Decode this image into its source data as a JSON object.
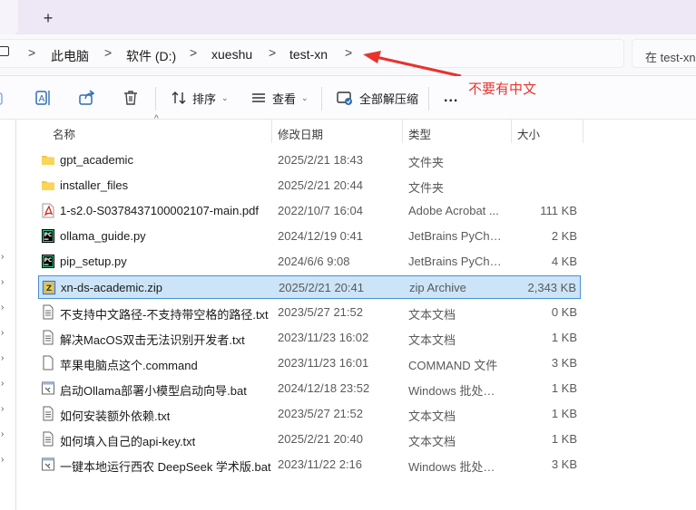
{
  "tabstrip": {
    "new_tab_label": "+"
  },
  "breadcrumb": {
    "items": [
      "此电脑",
      "软件 (D:)",
      "xueshu",
      "test-xn"
    ],
    "separator": ">"
  },
  "search": {
    "placeholder": "在 test-xn"
  },
  "annotation": {
    "text": "不要有中文",
    "color": "#e8322e"
  },
  "toolbar": {
    "sort_label": "排序",
    "view_label": "查看",
    "extract_all_label": "全部解压缩",
    "more_label": "..."
  },
  "columns": {
    "name": "名称",
    "modified": "修改日期",
    "type": "类型",
    "size": "大小"
  },
  "files": [
    {
      "name": "gpt_academic",
      "date": "2025/2/21 18:43",
      "type": "文件夹",
      "size": "",
      "icon": "folder-icon"
    },
    {
      "name": "installer_files",
      "date": "2025/2/21 20:44",
      "type": "文件夹",
      "size": "",
      "icon": "folder-icon"
    },
    {
      "name": "1-s2.0-S0378437100002107-main.pdf",
      "date": "2022/10/7 16:04",
      "type": "Adobe Acrobat ...",
      "size": "111 KB",
      "icon": "pdf-icon"
    },
    {
      "name": "ollama_guide.py",
      "date": "2024/12/19 0:41",
      "type": "JetBrains PyChar...",
      "size": "2 KB",
      "icon": "pycharm-icon"
    },
    {
      "name": "pip_setup.py",
      "date": "2024/6/6 9:08",
      "type": "JetBrains PyChar...",
      "size": "4 KB",
      "icon": "pycharm-icon"
    },
    {
      "name": "xn-ds-academic.zip",
      "date": "2025/2/21 20:41",
      "type": "zip Archive",
      "size": "2,343 KB",
      "icon": "zip-icon",
      "selected": true
    },
    {
      "name": "不支持中文路径-不支持带空格的路径.txt",
      "date": "2023/5/27 21:52",
      "type": "文本文档",
      "size": "0 KB",
      "icon": "text-file-icon"
    },
    {
      "name": "解决MacOS双击无法识别开发者.txt",
      "date": "2023/11/23 16:02",
      "type": "文本文档",
      "size": "1 KB",
      "icon": "text-file-icon"
    },
    {
      "name": "苹果电脑点这个.command",
      "date": "2023/11/23 16:01",
      "type": "COMMAND 文件",
      "size": "3 KB",
      "icon": "blank-file-icon"
    },
    {
      "name": "启动Ollama部署小模型启动向导.bat",
      "date": "2024/12/18 23:52",
      "type": "Windows 批处理...",
      "size": "1 KB",
      "icon": "bat-file-icon"
    },
    {
      "name": "如何安装额外依赖.txt",
      "date": "2023/5/27 21:52",
      "type": "文本文档",
      "size": "1 KB",
      "icon": "text-file-icon"
    },
    {
      "name": "如何填入自己的api-key.txt",
      "date": "2025/2/21 20:40",
      "type": "文本文档",
      "size": "1 KB",
      "icon": "text-file-icon"
    },
    {
      "name": "一键本地运行西农 DeepSeek 学术版.bat",
      "date": "2023/11/22 2:16",
      "type": "Windows 批处理...",
      "size": "3 KB",
      "icon": "bat-file-icon"
    }
  ]
}
